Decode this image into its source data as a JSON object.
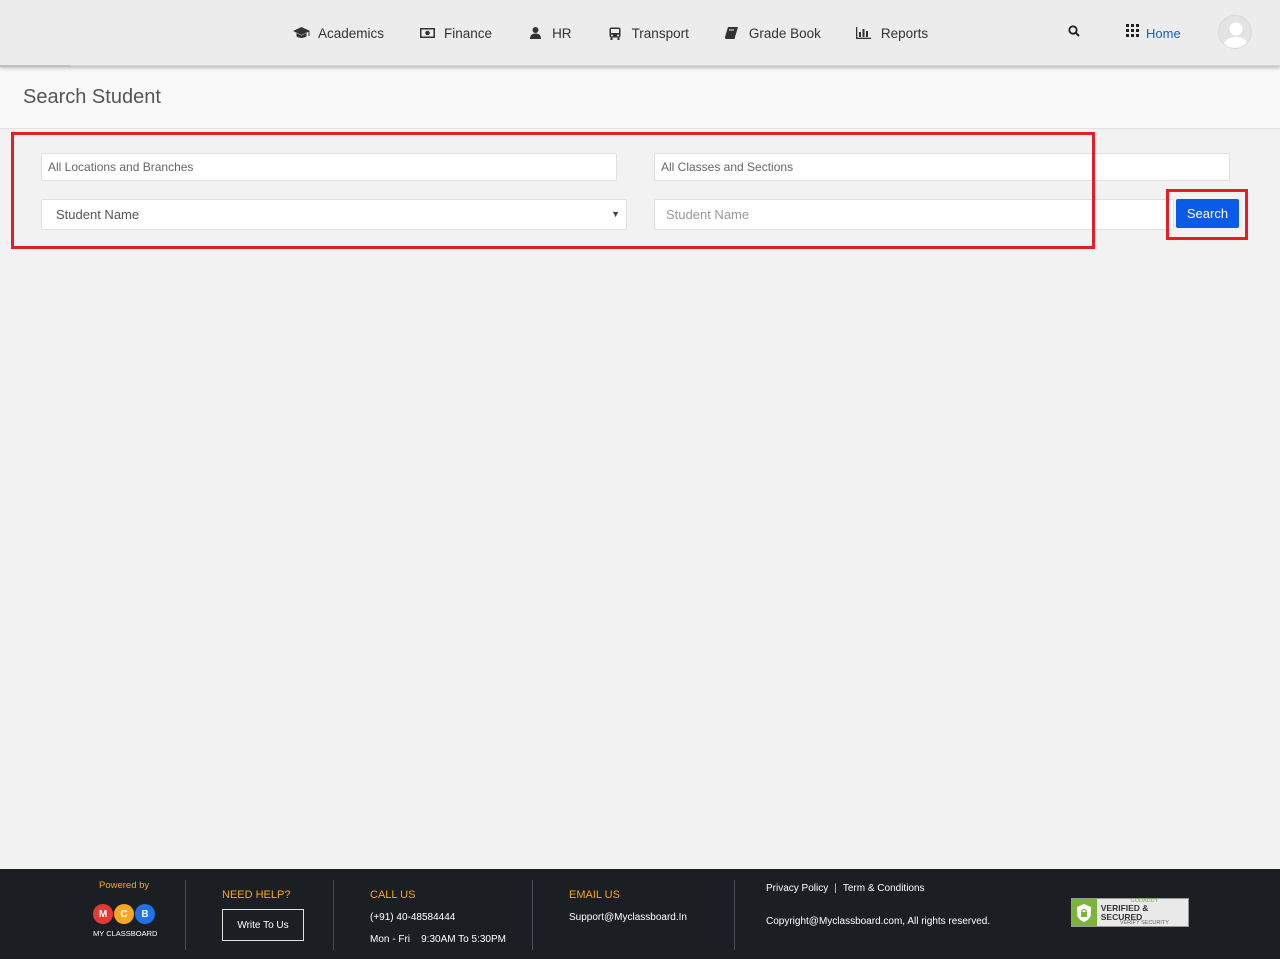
{
  "nav": {
    "items": [
      {
        "label": "Academics",
        "icon": "graduation-cap-icon"
      },
      {
        "label": "Finance",
        "icon": "money-icon"
      },
      {
        "label": "HR",
        "icon": "user-icon"
      },
      {
        "label": "Transport",
        "icon": "bus-icon"
      },
      {
        "label": "Grade Book",
        "icon": "book-icon"
      },
      {
        "label": "Reports",
        "icon": "bar-chart-icon"
      }
    ],
    "home_label": "Home"
  },
  "page": {
    "title": "Search Student"
  },
  "form": {
    "location_placeholder": "All Locations and Branches",
    "class_placeholder": "All Classes and Sections",
    "search_by_selected": "Student Name",
    "student_input_placeholder": "Student Name",
    "search_button": "Search"
  },
  "footer": {
    "powered_by": "Powered by",
    "logo_letters": [
      "M",
      "C",
      "B"
    ],
    "logo_caption": "MY CLASSBOARD",
    "need_help": "NEED HELP?",
    "write_to_us": "Write To Us",
    "call_us": "CALL US",
    "phone": "(+91) 40-48584444",
    "hours": "Mon - Fri    9:30AM To 5:30PM",
    "email_us": "EMAIL US",
    "email": "Support@Myclassboard.In",
    "privacy": "Privacy Policy",
    "terms": "Term & Conditions",
    "copyright": "Copyright@Myclassboard.com, All rights reserved.",
    "badge_top": "GODADDY",
    "badge_main": "VERIFIED & SECURED",
    "badge_bottom": "VERIFY SECURITY"
  },
  "colors": {
    "accent": "#0a5ce6",
    "highlight": "#e41e26",
    "footer_bg": "#1b1f24",
    "footer_heading": "#f5a623",
    "logo_m": "#e53935",
    "logo_c": "#f5a623",
    "logo_b": "#1e73e8"
  }
}
